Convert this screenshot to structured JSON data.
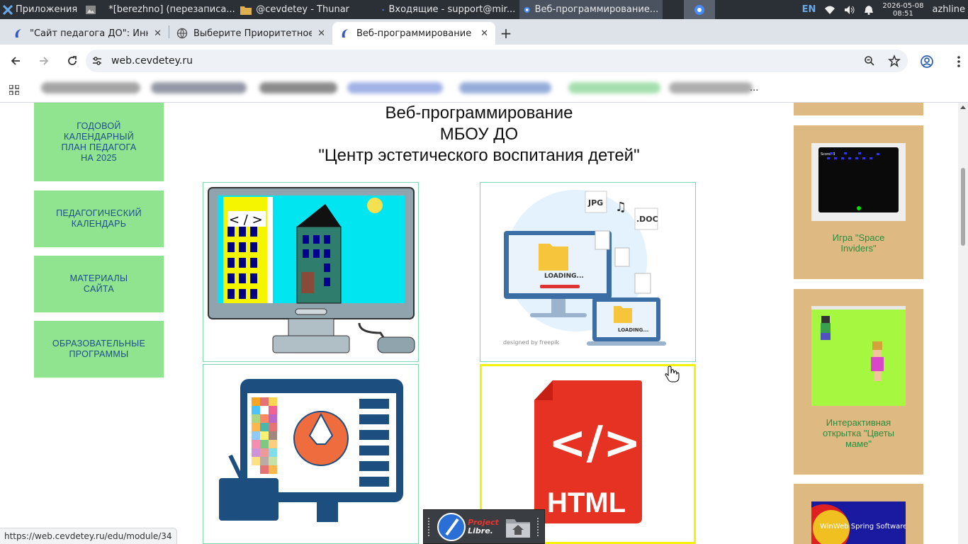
{
  "os_panel": {
    "apps_label": "Приложения",
    "tasks": [
      {
        "label": "",
        "icon": "image-viewer-icon",
        "active": false
      },
      {
        "label": "*[berezhno] (перезаписа...",
        "icon": "image-editor-icon",
        "active": false
      },
      {
        "label": "@cevdetey - Thunar",
        "icon": "folder-icon",
        "active": false
      },
      {
        "label": "Входящие - support@mir...",
        "icon": "mail-icon",
        "active": false
      },
      {
        "label": "Веб-программирование...",
        "icon": "chromium-icon",
        "active": true
      }
    ],
    "language": "EN",
    "date": "2026-05-08",
    "time": "08:51",
    "user": "azhline"
  },
  "browser": {
    "tabs": [
      {
        "title": "\"Сайт педагога ДО\": Инно",
        "active": false
      },
      {
        "title": "Выберите Приоритетное н",
        "active": false
      },
      {
        "title": "Веб-программирование в",
        "active": true
      }
    ],
    "url": "web.cevdetey.ru",
    "bookmarks_more": "..."
  },
  "sidebar": {
    "items": [
      {
        "label": "ГОДОВОЙ КАЛЕНДАРНЫЙ ПЛАН ПЕДАГОГА НА 2025",
        "lines": [
          "ГОДОВОЙ",
          "КАЛЕНДАРНЫЙ",
          "ПЛАН ПЕДАГОГА",
          "НА 2025"
        ]
      },
      {
        "label": "ПЕДАГОГИЧЕСКИЙ КАЛЕНДАРЬ",
        "lines": [
          "ПЕДАГОГИЧЕСКИЙ",
          "КАЛЕНДАРЬ"
        ]
      },
      {
        "label": "МАТЕРИАЛЫ САЙТА",
        "lines": [
          "МАТЕРИАЛЫ",
          "САЙТА"
        ]
      },
      {
        "label": "ОБРАЗОВАТЕЛЬНЫЕ ПРОГРАММЫ",
        "lines": [
          "ОБРАЗОВАТЕЛЬНЫЕ",
          "ПРОГРАММЫ"
        ]
      }
    ]
  },
  "main": {
    "title_lines": [
      "Веб-программирование",
      "МБОУ ДО",
      "\"Центр эстетического воспитания детей\""
    ],
    "cards": [
      {
        "name": "paint-city-card",
        "caption": ""
      },
      {
        "name": "file-loading-card",
        "labels": [
          "JPG",
          ".DOC",
          "LOADING...",
          "LOADING...",
          "designed by freepik"
        ]
      },
      {
        "name": "graphic-design-card",
        "caption": ""
      },
      {
        "name": "html-card",
        "labels": [
          "HTML"
        ]
      }
    ]
  },
  "right_column": {
    "items": [
      {
        "label": "Игра \"Space Inviders\"",
        "lines": [
          "Игра \"Space",
          "Inviders\""
        ],
        "thumb_text": "Score: 3"
      },
      {
        "label": "Интерактивная открытка \"Цветы маме\"",
        "lines": [
          "Интерактивная",
          "открытка \"Цветы",
          "маме\""
        ]
      },
      {
        "label": "",
        "thumb_text": "WinWeb Spring Software"
      }
    ]
  },
  "status_bar": {
    "url": "https://web.cevdetey.ru/edu/module/34"
  },
  "dock": {
    "app_label_line1": "Project",
    "app_label_line2": "Libre."
  },
  "colors": {
    "sidebar_bg": "#90e490",
    "sidebar_text": "#1e4d8c",
    "right_bg": "#deba82",
    "right_text": "#2e8b3e",
    "card_border": "#7fd9b4",
    "selected_border": "#f3f30a"
  }
}
